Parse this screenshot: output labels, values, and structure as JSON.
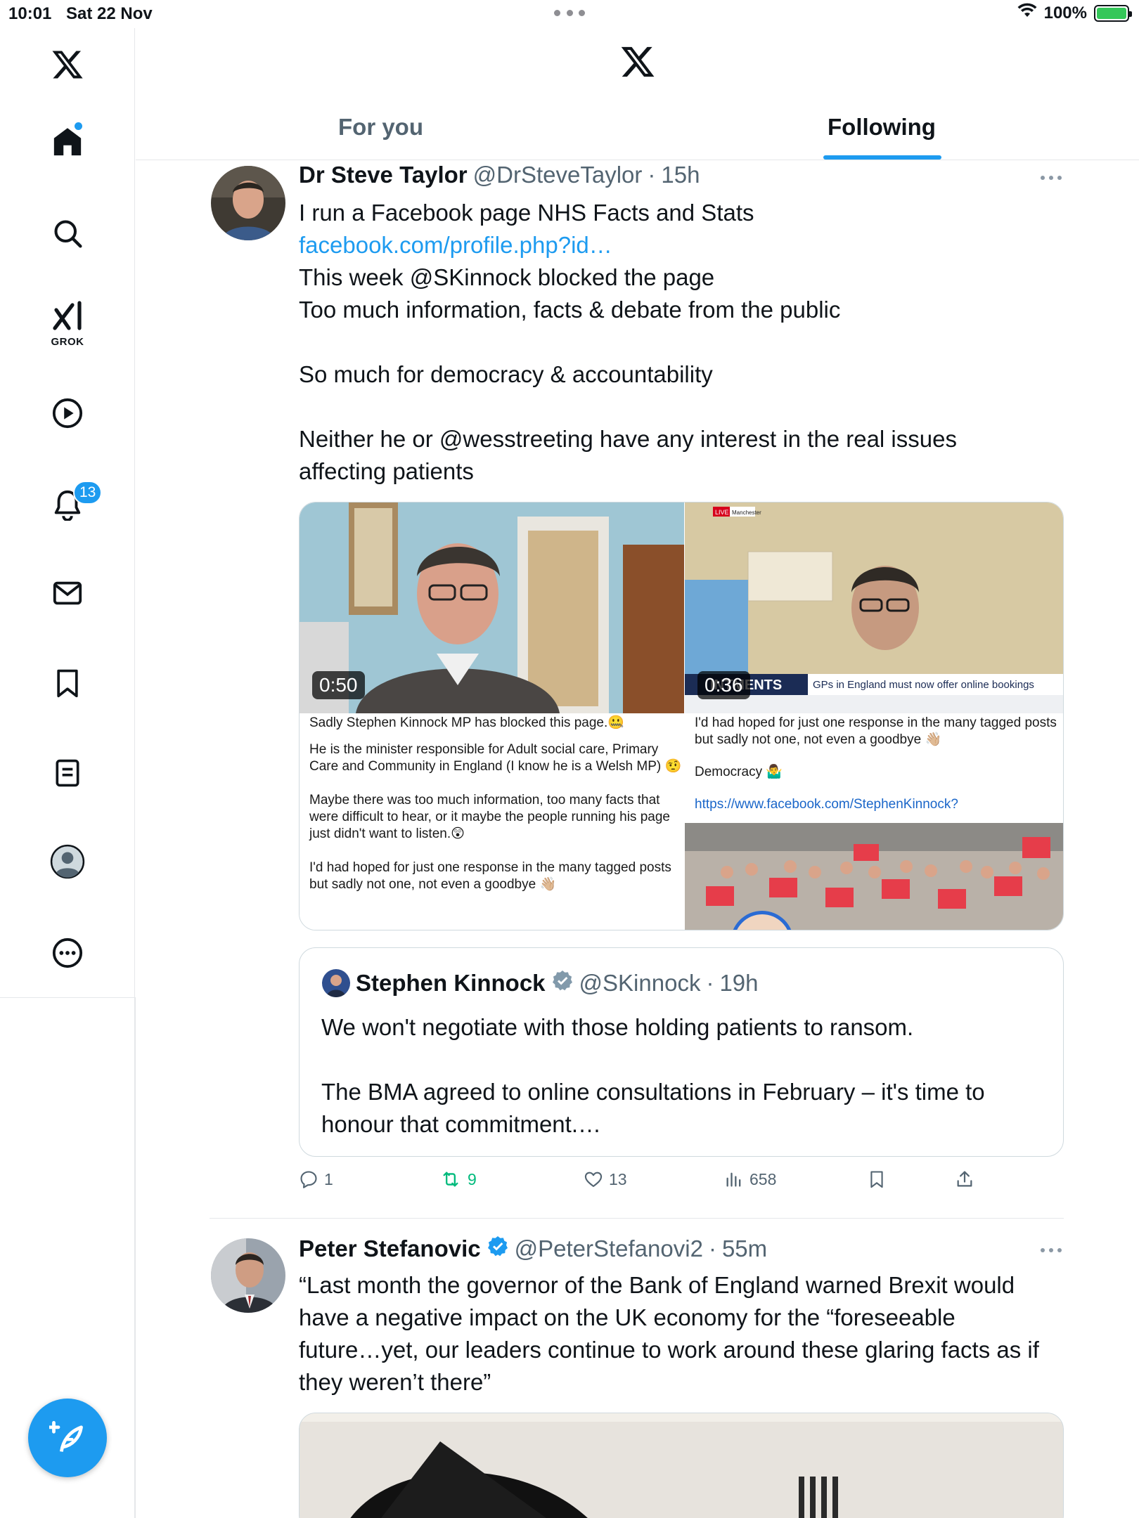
{
  "status_bar": {
    "time": "10:01",
    "date": "Sat 22 Nov",
    "battery": "100%"
  },
  "sidebar": {
    "grok_label": "GROK",
    "notifications_badge": "13"
  },
  "tabs": [
    {
      "label": "For you",
      "active": false
    },
    {
      "label": "Following",
      "active": true
    }
  ],
  "tweets": [
    {
      "name": "Dr Steve Taylor",
      "handle": "@DrSteveTaylor",
      "time": "15h",
      "lines": [
        "I run a Facebook page NHS Facts and Stats",
        "facebook.com/profile.php?id…",
        "This week @SKinnock blocked the page",
        "Too much information, facts & debate from the public",
        "",
        "So much for democracy & accountability",
        "",
        "Neither he or @wesstreeting have any interest in the real issues",
        "affecting patients"
      ],
      "media": [
        {
          "duration": "0:50",
          "doc_text": [
            "Sadly Stephen Kinnock MP has blocked this page.🤐",
            "He is the minister responsible for Adult social care, Primary Care and Community in England (I know he is a Welsh MP) 🤨",
            "Maybe there was too much information, too many facts that were difficult to hear, or it maybe the people running his page just didn't want to listen.😲",
            "I'd had hoped for just one response in the many tagged posts but sadly not one, not even a goodbye 👋🏼"
          ]
        },
        {
          "duration": "0:36",
          "tv_ticker": "INTMENTS",
          "tv_headline": "GPs in England must now offer online bookings",
          "live_tag": "LIVE",
          "live_location": "Manchester",
          "doc_text": [
            "I'd had hoped for just one response in the many tagged posts but sadly not one, not even a goodbye 👋🏼",
            "Democracy 🤷‍♂️"
          ],
          "doc_link": "https://www.facebook.com/StephenKinnock?"
        }
      ],
      "quote": {
        "name": "Stephen Kinnock",
        "handle": "@SKinnock",
        "time": "19h",
        "lines": [
          "We won't negotiate with those holding patients to ransom.",
          "",
          "The BMA agreed to online consultations in February – it's time to",
          "honour that commitment.…"
        ]
      },
      "stats": {
        "replies": "1",
        "reposts": "9",
        "likes": "13",
        "views": "658"
      }
    },
    {
      "name": "Peter Stefanovic",
      "handle": "@PeterStefanovi2",
      "time": "55m",
      "lines": [
        "“Last month the governor of the Bank of England warned Brexit would",
        "have a negative impact on the UK economy for the “foreseeable",
        "future…yet, our leaders continue to work around these glaring facts as if",
        "they weren’t there”"
      ]
    }
  ],
  "colors": {
    "accent": "#1d9bf0",
    "repost": "#00ba7c",
    "secondary_text": "#536471"
  }
}
